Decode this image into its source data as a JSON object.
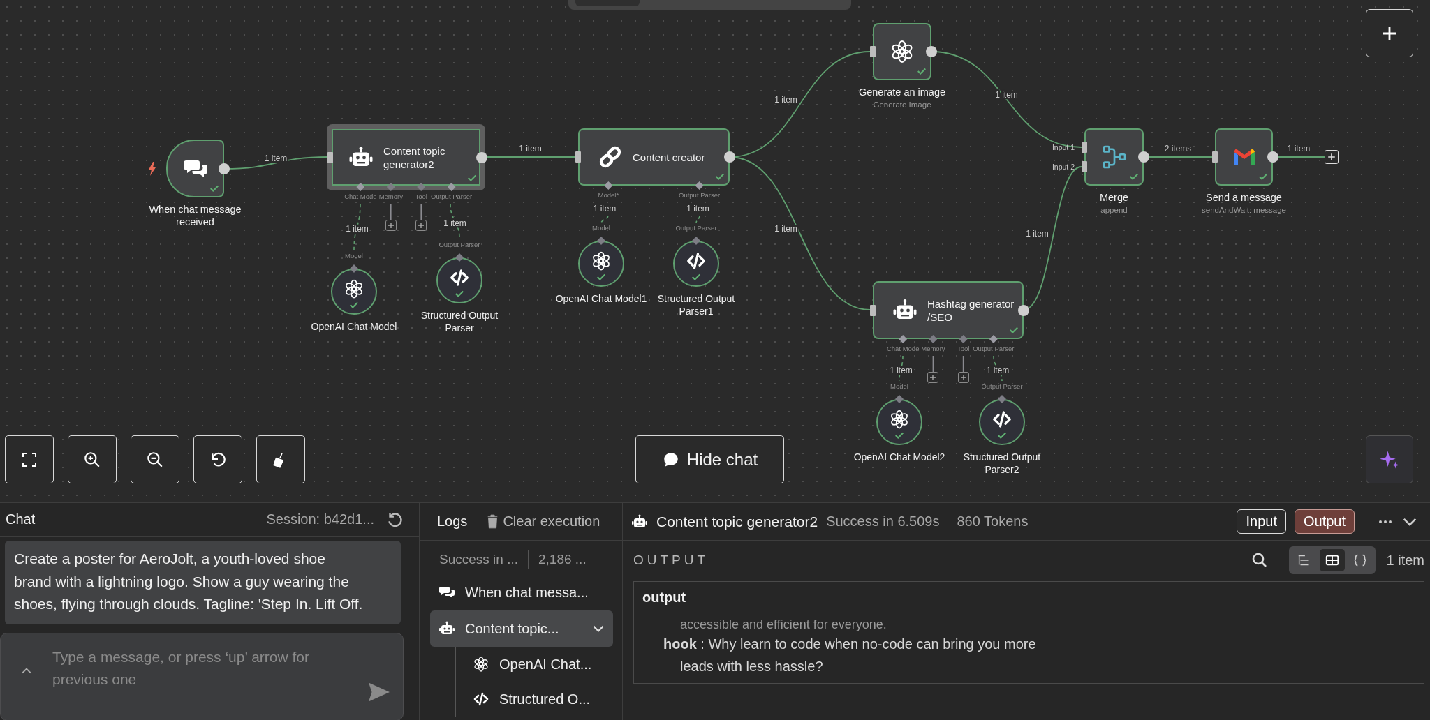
{
  "canvas": {
    "nodes": [
      {
        "kind": "trigger",
        "title": "When chat message received",
        "success": true,
        "selected": false
      },
      {
        "kind": "wide",
        "title": "Content topic generator2",
        "success": true,
        "selected": true,
        "handles": [
          {
            "label": "Chat Mode",
            "connected": true
          },
          {
            "label": "Memory",
            "connected": false
          },
          {
            "label": "Tool",
            "connected": false
          },
          {
            "label": "Output Parser",
            "connected": true
          }
        ]
      },
      {
        "kind": "sub",
        "title": "OpenAI Chat Model",
        "input_label": "Model",
        "success": true,
        "selected": false
      },
      {
        "kind": "sub",
        "title": "Structured Output Parser",
        "input_label": "Output Parser",
        "success": true,
        "selected": false
      },
      {
        "kind": "wide",
        "title": "Content creator",
        "success": true,
        "selected": false,
        "handles": [
          {
            "label": "Model*",
            "connected": true
          },
          {
            "label": "Output Parser",
            "connected": true
          }
        ]
      },
      {
        "kind": "sub",
        "title": "OpenAI Chat Model1",
        "input_label": "Model",
        "success": true,
        "selected": false
      },
      {
        "kind": "sub",
        "title": "Structured Output Parser1",
        "input_label": "Output Parser",
        "success": true,
        "selected": false
      },
      {
        "kind": "square",
        "title": "Generate an image",
        "subtitle": "Generate Image",
        "success": true,
        "selected": false
      },
      {
        "kind": "wide",
        "title": "Hashtag generator /SEO",
        "success": true,
        "selected": false,
        "handles": [
          {
            "label": "Chat Mode",
            "connected": true
          },
          {
            "label": "Memory",
            "connected": false
          },
          {
            "label": "Tool",
            "connected": false
          },
          {
            "label": "Output Parser",
            "connected": true
          }
        ]
      },
      {
        "kind": "sub",
        "title": "OpenAI Chat Model2",
        "input_label": "Model",
        "success": true,
        "selected": false
      },
      {
        "kind": "sub",
        "title": "Structured Output Parser2",
        "input_label": "Output Parser",
        "success": true,
        "selected": false
      },
      {
        "kind": "square",
        "title": "Merge",
        "subtitle": "append",
        "inputs": [
          "Input 1",
          "Input 2"
        ],
        "success": true,
        "selected": false
      },
      {
        "kind": "square",
        "title": "Send a message",
        "subtitle": "sendAndWait: message",
        "success": true,
        "selected": false
      }
    ],
    "edges": [
      {
        "kind": "main",
        "label": "1 item"
      },
      {
        "kind": "main",
        "label": "1 item"
      },
      {
        "kind": "main",
        "label": "1 item"
      },
      {
        "kind": "main",
        "label": "1 item"
      },
      {
        "kind": "main",
        "label": "1 item"
      },
      {
        "kind": "main",
        "label": "1 item"
      },
      {
        "kind": "main",
        "label": "2 items"
      },
      {
        "kind": "main",
        "label": "1 item"
      },
      {
        "kind": "sub",
        "label": "1 item"
      },
      {
        "kind": "sub",
        "label": "1 item"
      },
      {
        "kind": "sub",
        "label": "1 item"
      },
      {
        "kind": "sub",
        "label": "1 item"
      },
      {
        "kind": "sub",
        "label": "1 item"
      },
      {
        "kind": "sub",
        "label": "1 item"
      }
    ],
    "hide_chat_button": {
      "label": "Hide chat"
    }
  },
  "chat": {
    "title": "Chat",
    "session": "Session: b42d1...",
    "messages": [
      "Create a poster for AeroJolt, a youth-loved shoe brand with a lightning logo. Show a guy wearing the shoes, flying through clouds. Tagline: 'Step In. Lift Off."
    ],
    "input": {
      "placeholder": "Type a message, or press ‘up’ arrow for previous one"
    }
  },
  "logs": {
    "title": "Logs",
    "clear_label": "Clear execution",
    "summary": [
      "Success in ...",
      "2,186 ..."
    ],
    "items": [
      {
        "label": "When chat messa...",
        "selected": false
      },
      {
        "label": "Content topic...",
        "selected": true,
        "expanded": true,
        "children": [
          {
            "label": "OpenAI Chat...",
            "selected": false
          },
          {
            "label": "Structured O...",
            "selected": false
          }
        ]
      }
    ]
  },
  "output": {
    "node": "Content topic generator2",
    "status": "Success in 6.509s",
    "tokens": "860 Tokens",
    "modes": [
      {
        "label": "Input",
        "selected": false
      },
      {
        "label": "Output",
        "selected": true
      }
    ],
    "section": "OUTPUT",
    "views": [
      {
        "kind": "schema",
        "selected": false
      },
      {
        "kind": "table",
        "selected": true
      },
      {
        "kind": "json",
        "selected": false
      }
    ],
    "count": "1 item",
    "table": {
      "columns": [
        "output"
      ],
      "lines": [
        {
          "text": "accessible and efficient for everyone."
        },
        {
          "text": "**hook** : Why learn to code when no-code can bring you more leads with less hassle?"
        }
      ]
    }
  }
}
